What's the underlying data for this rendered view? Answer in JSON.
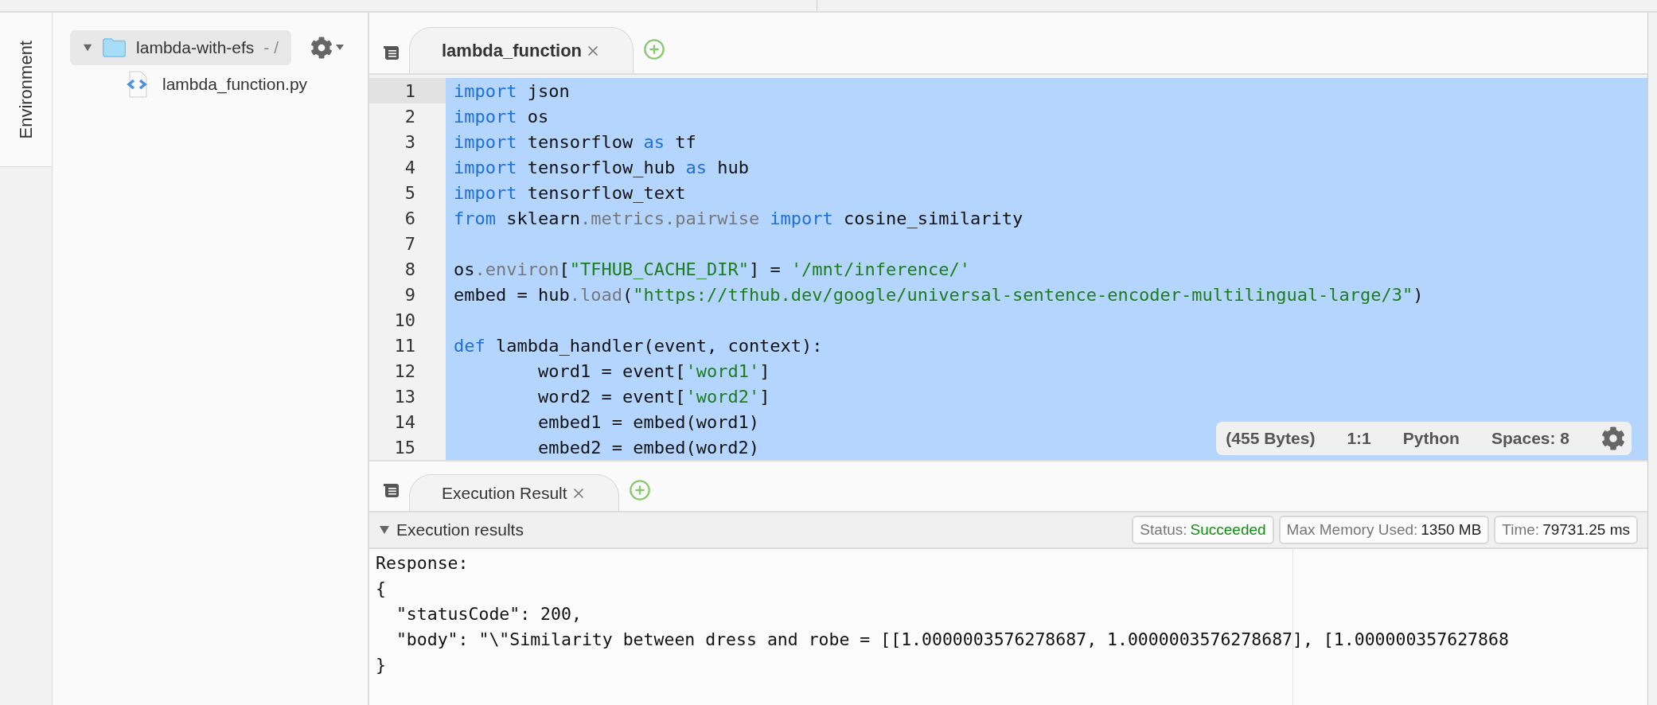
{
  "side_tabs": [
    {
      "label": "Environment",
      "selected": true
    }
  ],
  "file_tree": {
    "name": "lambda-with-efs",
    "suffix": "- /",
    "expanded": true,
    "selected": true,
    "children": [
      {
        "name": "lambda_function.py"
      }
    ]
  },
  "editor": {
    "tabs": [
      {
        "label": "lambda_function",
        "selected": true
      }
    ],
    "lines": [
      {
        "number": "1",
        "active": true,
        "selected": true,
        "tokens": [
          {
            "kind": "keyword",
            "text": "import"
          },
          {
            "kind": "plain",
            "text": " json"
          }
        ]
      },
      {
        "number": "2",
        "active": false,
        "selected": true,
        "tokens": [
          {
            "kind": "keyword",
            "text": "import"
          },
          {
            "kind": "plain",
            "text": " os"
          }
        ]
      },
      {
        "number": "3",
        "active": false,
        "selected": true,
        "tokens": [
          {
            "kind": "keyword",
            "text": "import"
          },
          {
            "kind": "plain",
            "text": " tensorflow "
          },
          {
            "kind": "keyword",
            "text": "as"
          },
          {
            "kind": "plain",
            "text": " tf"
          }
        ]
      },
      {
        "number": "4",
        "active": false,
        "selected": true,
        "tokens": [
          {
            "kind": "keyword",
            "text": "import"
          },
          {
            "kind": "plain",
            "text": " tensorflow_hub "
          },
          {
            "kind": "keyword",
            "text": "as"
          },
          {
            "kind": "plain",
            "text": " hub"
          }
        ]
      },
      {
        "number": "5",
        "active": false,
        "selected": true,
        "tokens": [
          {
            "kind": "keyword",
            "text": "import"
          },
          {
            "kind": "plain",
            "text": " tensorflow_text"
          }
        ]
      },
      {
        "number": "6",
        "active": false,
        "selected": true,
        "tokens": [
          {
            "kind": "keyword",
            "text": "from"
          },
          {
            "kind": "plain",
            "text": " sklearn"
          },
          {
            "kind": "attribute",
            "text": ".metrics.pairwise"
          },
          {
            "kind": "keyword",
            "text": " import"
          },
          {
            "kind": "plain",
            "text": " cosine_similarity"
          }
        ]
      },
      {
        "number": "7",
        "active": false,
        "selected": true
      },
      {
        "number": "8",
        "active": false,
        "selected": true,
        "tokens": [
          {
            "kind": "plain",
            "text": "os"
          },
          {
            "kind": "attribute",
            "text": ".environ"
          },
          {
            "kind": "plain",
            "text": "["
          },
          {
            "kind": "string",
            "text": "\"TFHUB_CACHE_DIR\""
          },
          {
            "kind": "plain",
            "text": "] = "
          },
          {
            "kind": "string",
            "text": "'/mnt/inference/'"
          }
        ]
      },
      {
        "number": "9",
        "active": false,
        "selected": true,
        "tokens": [
          {
            "kind": "plain",
            "text": "embed = hub"
          },
          {
            "kind": "attribute",
            "text": ".load"
          },
          {
            "kind": "plain",
            "text": "("
          },
          {
            "kind": "string",
            "text": "\"https://tfhub.dev/google/universal-sentence-encoder-multilingual-large/3\""
          },
          {
            "kind": "plain",
            "text": ")"
          }
        ]
      },
      {
        "number": "10",
        "active": false,
        "selected": true
      },
      {
        "number": "11",
        "active": false,
        "selected": true,
        "tokens": [
          {
            "kind": "keyword",
            "text": "def"
          },
          {
            "kind": "plain",
            "text": " lambda_handler(event, context):"
          }
        ]
      },
      {
        "number": "12",
        "active": false,
        "selected": true,
        "tokens": [
          {
            "kind": "plain",
            "text": "        word1 = event["
          },
          {
            "kind": "string",
            "text": "'word1'"
          },
          {
            "kind": "plain",
            "text": "]"
          }
        ]
      },
      {
        "number": "13",
        "active": false,
        "selected": true,
        "tokens": [
          {
            "kind": "plain",
            "text": "        word2 = event["
          },
          {
            "kind": "string",
            "text": "'word2'"
          },
          {
            "kind": "plain",
            "text": "]"
          }
        ]
      },
      {
        "number": "14",
        "active": false,
        "selected": true,
        "tokens": [
          {
            "kind": "plain",
            "text": "        embed1 = embed(word1)"
          }
        ]
      },
      {
        "number": "15",
        "active": false,
        "selected": true,
        "tokens": [
          {
            "kind": "plain",
            "text": "        embed2 = embed(word2)"
          }
        ]
      }
    ],
    "status_bar": [
      "(455 Bytes)",
      "1:1",
      "Python",
      "Spaces: 8"
    ]
  },
  "results": {
    "tabs": [
      {
        "label": "Execution Result",
        "selected": true
      }
    ],
    "section": {
      "title": "Execution results",
      "expanded": true
    },
    "pills": [
      {
        "label": "Status:",
        "value": "Succeeded",
        "kind": "status"
      },
      {
        "label": "Max Memory Used:",
        "value": "1350 MB",
        "kind": "metric"
      },
      {
        "label": "Time:",
        "value": "79731.25 ms",
        "kind": "metric"
      }
    ],
    "output": [
      "Response:",
      "{",
      "  \"statusCode\": 200,",
      "  \"body\": \"\\\"Similarity between dress and robe = [[1.0000003576278687, 1.0000003576278687], [1.000000357627868",
      "}"
    ]
  }
}
